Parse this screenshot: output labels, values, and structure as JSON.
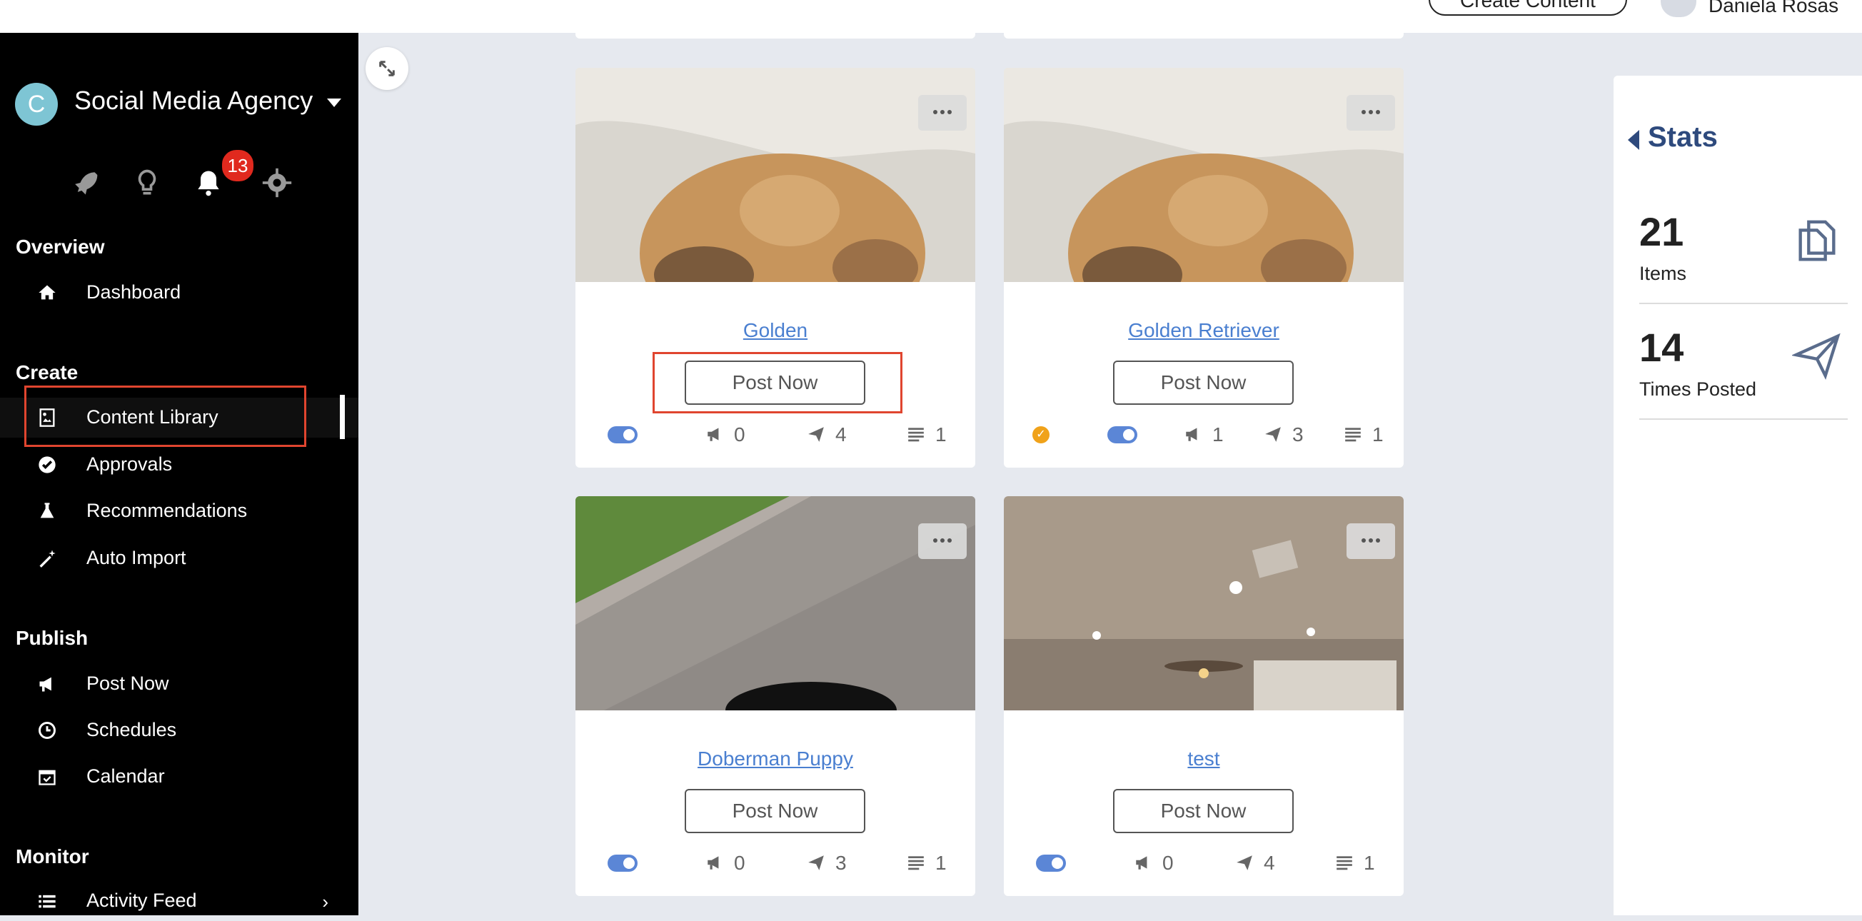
{
  "header": {
    "create_content_label": "Create Content",
    "user_name": "Daniela Rosas"
  },
  "sidebar": {
    "org_initial": "C",
    "org_name": "Social Media Agency",
    "notifications_count": "13",
    "sections": {
      "overview": "Overview",
      "create": "Create",
      "publish": "Publish",
      "monitor": "Monitor"
    },
    "items": {
      "dashboard": "Dashboard",
      "content_library": "Content Library",
      "approvals": "Approvals",
      "recommendations": "Recommendations",
      "auto_import": "Auto Import",
      "post_now": "Post Now",
      "schedules": "Schedules",
      "calendar": "Calendar",
      "activity_feed": "Activity Feed"
    }
  },
  "cards": [
    {
      "title": "Golden",
      "button": "Post Now",
      "approved": false,
      "enabled": true,
      "campaigns": "0",
      "posted": "4",
      "queues": "1"
    },
    {
      "title": "Golden Retriever",
      "button": "Post Now",
      "approved": true,
      "enabled": true,
      "campaigns": "1",
      "posted": "3",
      "queues": "1"
    },
    {
      "title": "Doberman Puppy",
      "button": "Post Now",
      "approved": false,
      "enabled": true,
      "campaigns": "0",
      "posted": "3",
      "queues": "1"
    },
    {
      "title": "test",
      "button": "Post Now",
      "approved": false,
      "enabled": true,
      "campaigns": "0",
      "posted": "4",
      "queues": "1"
    }
  ],
  "stats": {
    "title": "Stats",
    "items_count": "21",
    "items_label": "Items",
    "times_posted_count": "14",
    "times_posted_label": "Times Posted"
  },
  "colors": {
    "accent": "#4a7fd0",
    "sidebar_bg": "#000000",
    "highlight": "#e0452f",
    "badge": "#e0291e",
    "approved": "#f0a21a"
  }
}
